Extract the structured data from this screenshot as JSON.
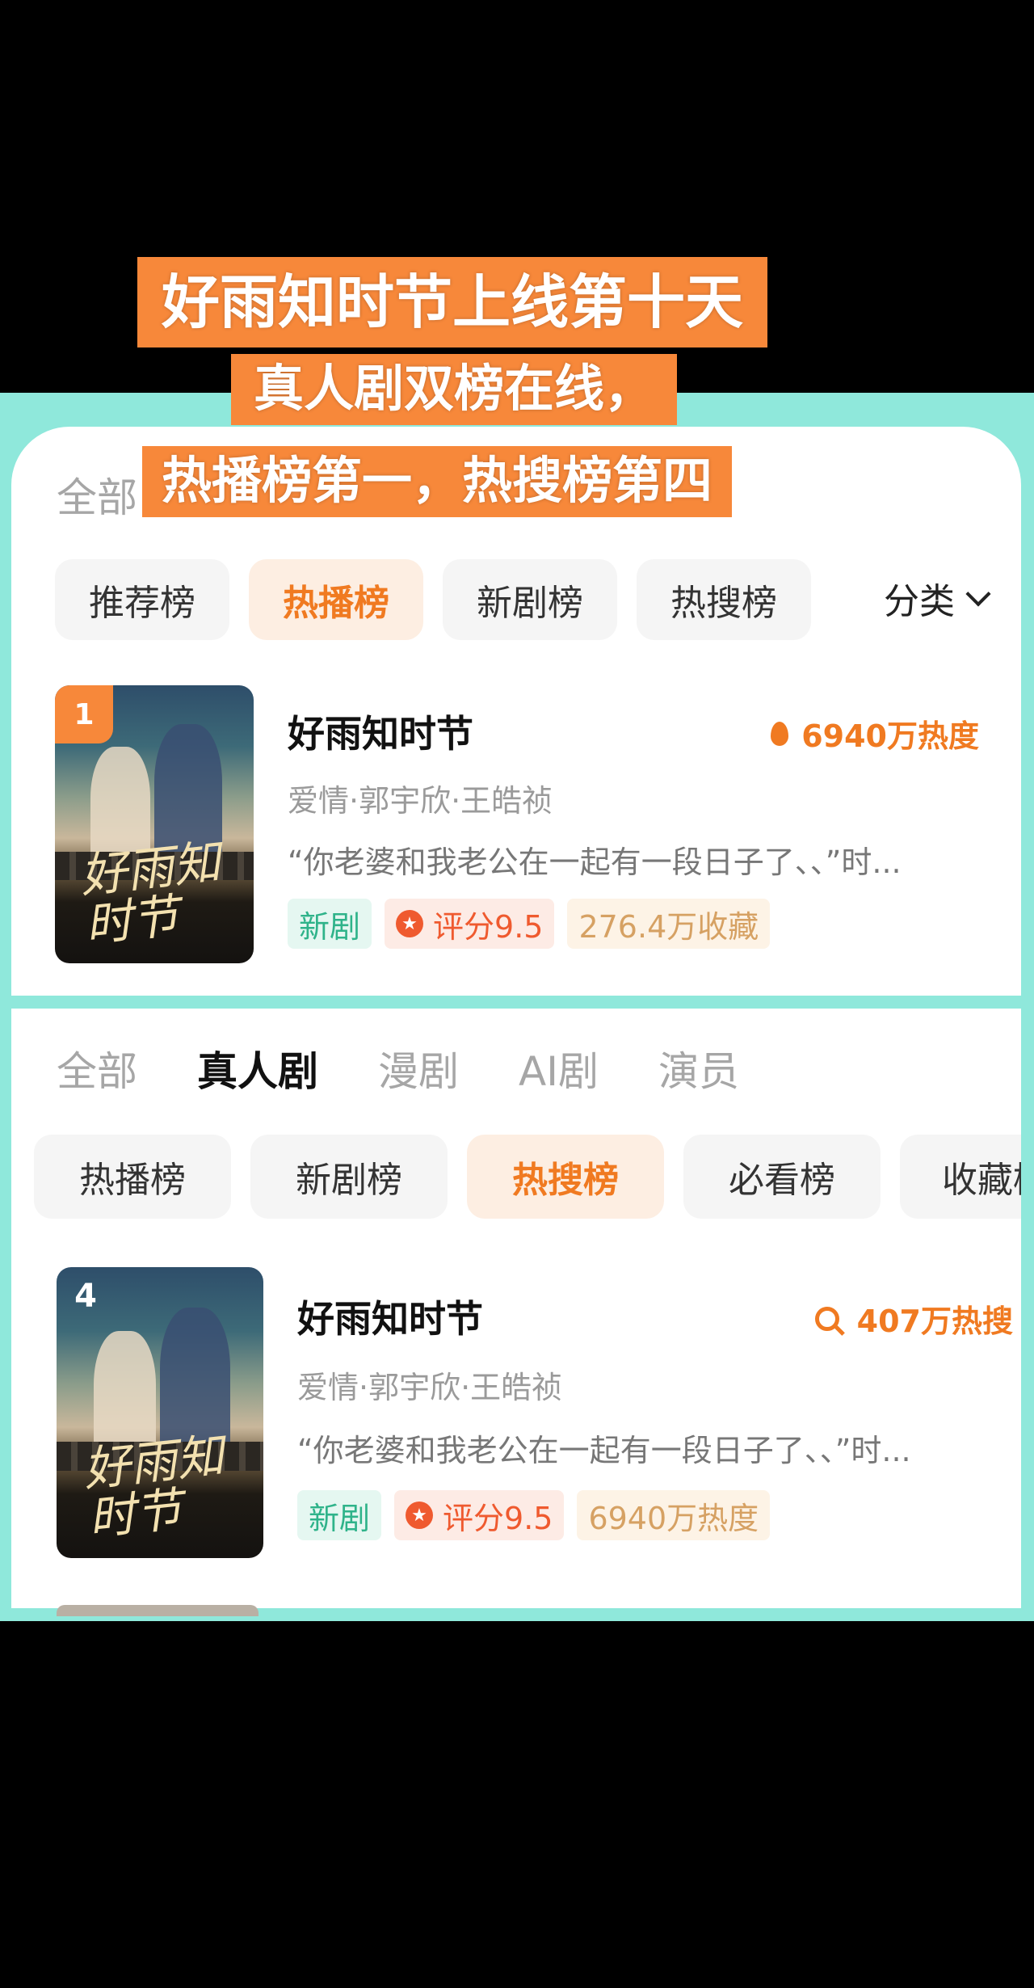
{
  "captions": {
    "line1": "好雨知时节上线第十天",
    "line2": "真人剧双榜在线，",
    "line3": "热播榜第一，热搜榜第四"
  },
  "panel1": {
    "top_tab_partial": "全部",
    "pills": [
      "推荐榜",
      "热播榜",
      "新剧榜",
      "热搜榜"
    ],
    "active_pill": "热播榜",
    "sort_label": "分类",
    "item": {
      "rank": "1",
      "title": "好雨知时节",
      "heat": "6940万热度",
      "meta": "爱情·郭宇欣·王皓祯",
      "desc": "“你老婆和我老公在一起有一段日子了、、”时...",
      "tags": {
        "new": "新剧",
        "rating": "评分9.5",
        "extra": "276.4万收藏"
      },
      "poster_title": "好雨知时节"
    }
  },
  "panel2": {
    "top_tabs": [
      "全部",
      "真人剧",
      "漫剧",
      "AI剧",
      "演员"
    ],
    "active_top_tab": "真人剧",
    "pills": [
      "热播榜",
      "新剧榜",
      "热搜榜",
      "必看榜",
      "收藏榜"
    ],
    "active_pill": "热搜榜",
    "item": {
      "rank": "4",
      "title": "好雨知时节",
      "heat": "407万热搜",
      "meta": "爱情·郭宇欣·王皓祯",
      "desc": "“你老婆和我老公在一起有一段日子了、、”时...",
      "tags": {
        "new": "新剧",
        "rating": "评分9.5",
        "extra": "6940万热度"
      },
      "poster_title": "好雨知时节"
    }
  },
  "colors": {
    "accent": "#f07a21",
    "frame": "#8fe8db",
    "caption_bg": "#f7883a"
  },
  "icons": {
    "heat": "flame-icon",
    "search_heat": "search-icon",
    "rating": "star-icon",
    "sort": "chevron-down-icon"
  }
}
